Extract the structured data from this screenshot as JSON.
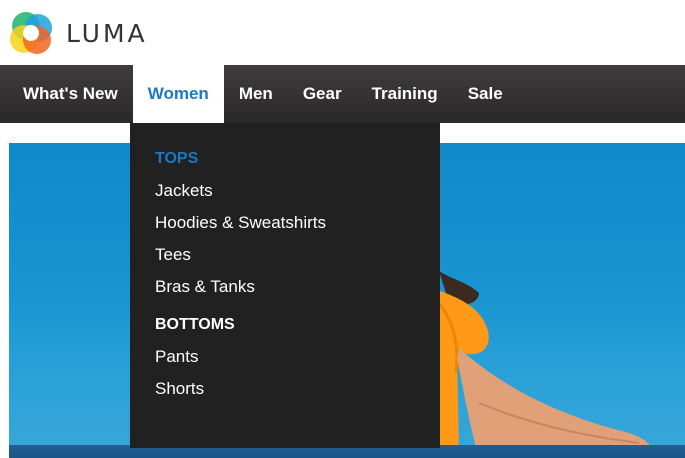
{
  "brand": {
    "name": "LUMA",
    "logo_icon": "luma-logo-icon"
  },
  "nav": {
    "items": [
      {
        "label": "What's New",
        "active": false
      },
      {
        "label": "Women",
        "active": true
      },
      {
        "label": "Men",
        "active": false
      },
      {
        "label": "Gear",
        "active": false
      },
      {
        "label": "Training",
        "active": false
      },
      {
        "label": "Sale",
        "active": false
      }
    ]
  },
  "dropdown": {
    "tops": {
      "heading": "TOPS",
      "links": [
        "Jackets",
        "Hoodies & Sweatshirts",
        "Tees",
        "Bras & Tanks"
      ]
    },
    "bottoms": {
      "heading": "BOTTOMS",
      "links": [
        "Pants",
        "Shorts"
      ]
    }
  },
  "colors": {
    "nav_bg": "#333131",
    "accent": "#1979c3",
    "dropdown_bg": "#222121",
    "hero_sky": "#1894d0",
    "shirt": "#ff9a18"
  }
}
